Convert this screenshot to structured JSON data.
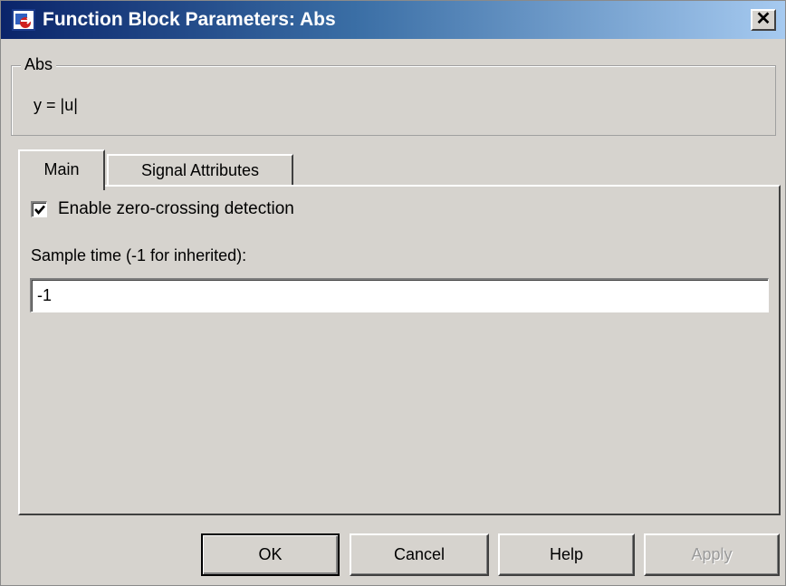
{
  "window": {
    "title": "Function Block Parameters: Abs",
    "close_label": "✕"
  },
  "description": {
    "group_label": "Abs",
    "text": "y = |u|"
  },
  "tabs": [
    {
      "label": "Main",
      "selected": true
    },
    {
      "label": "Signal Attributes",
      "selected": false
    }
  ],
  "main": {
    "zero_crossing": {
      "label": "Enable zero-crossing detection",
      "checked": true
    },
    "sample_time": {
      "label": "Sample time (-1 for inherited):",
      "value": "-1"
    }
  },
  "buttons": {
    "ok": "OK",
    "cancel": "Cancel",
    "help": "Help",
    "apply": "Apply"
  },
  "icons": {
    "app": "simulink-block-icon",
    "close": "close-icon",
    "checkmark": "checkmark-icon"
  },
  "colors": {
    "titlebar_start": "#0a246a",
    "titlebar_end": "#a6caf0",
    "dialog_bg": "#d6d3ce",
    "disabled_text": "#9a9a9a"
  }
}
